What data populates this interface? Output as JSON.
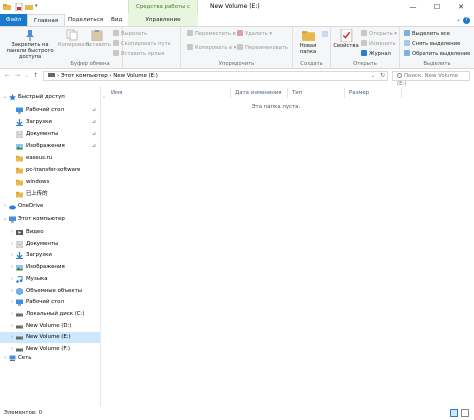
{
  "titlebar": {
    "context_tab": "Средства работы с дисками",
    "window_title": "New Volume (E:)",
    "minimize": "—",
    "maximize": "☐",
    "close": "✕"
  },
  "tabs": {
    "file": "Файл",
    "home": "Главная",
    "share": "Поделиться",
    "view": "Вид",
    "manage": "Управление"
  },
  "ribbon": {
    "clipboard": {
      "pin": "Закрепить на панели быстрого доступа",
      "copy": "Копировать",
      "paste": "Вставить",
      "cut": "Вырезать",
      "copy_path": "Скопировать путь",
      "paste_shortcut": "Вставить ярлык",
      "label": "Буфер обмена"
    },
    "organize": {
      "move_to": "Переместить в ▾",
      "copy_to": "Копировать в ▾",
      "delete": "Удалить ▾",
      "rename": "Переименовать",
      "label": "Упорядочить"
    },
    "new": {
      "new_folder": "Новая папка",
      "label": "Создать"
    },
    "open": {
      "properties": "Свойства",
      "open": "Открыть ▾",
      "edit": "Изменить",
      "history": "Журнал",
      "label": "Открыть"
    },
    "select": {
      "select_all": "Выделить все",
      "select_none": "Снять выделение",
      "invert": "Обратить выделение",
      "label": "Выделить"
    }
  },
  "address": {
    "path": "› Этот компьютер  ›  New Volume (E:)",
    "search_placeholder": "Поиск: New Volume (E:)"
  },
  "nav": {
    "quick_access": "Быстрый доступ",
    "items_quick": [
      {
        "label": "Рабочий стол",
        "icon": "desktop-icon",
        "pinned": true
      },
      {
        "label": "Загрузки",
        "icon": "downloads-icon",
        "pinned": true
      },
      {
        "label": "Документы",
        "icon": "documents-icon",
        "pinned": true
      },
      {
        "label": "Изображения",
        "icon": "pictures-icon",
        "pinned": true
      },
      {
        "label": "easeus.ru",
        "icon": "folder-icon",
        "pinned": false
      },
      {
        "label": "pc-transfer-software",
        "icon": "folder-icon",
        "pinned": false
      },
      {
        "label": "windows",
        "icon": "folder-icon",
        "pinned": false
      },
      {
        "label": "已上传的",
        "icon": "folder-icon",
        "pinned": false
      }
    ],
    "onedrive": "OneDrive",
    "this_pc": "Этот компьютер",
    "items_pc": [
      {
        "label": "Видео",
        "icon": "video-icon"
      },
      {
        "label": "Документы",
        "icon": "documents-icon"
      },
      {
        "label": "Загрузки",
        "icon": "downloads-icon"
      },
      {
        "label": "Изображения",
        "icon": "pictures-icon"
      },
      {
        "label": "Музыка",
        "icon": "music-icon"
      },
      {
        "label": "Объемные объекты",
        "icon": "3d-objects-icon"
      },
      {
        "label": "Рабочий стол",
        "icon": "desktop-icon"
      },
      {
        "label": "Локальный диск (C:)",
        "icon": "drive-icon"
      },
      {
        "label": "New Volume (D:)",
        "icon": "drive-icon"
      },
      {
        "label": "New Volume (E:)",
        "icon": "drive-icon",
        "selected": true
      },
      {
        "label": "New Volume (F:)",
        "icon": "drive-icon"
      }
    ],
    "network": "Сеть"
  },
  "content": {
    "columns": [
      "Имя",
      "Дата изменения",
      "Тип",
      "Размер"
    ],
    "empty_message": "Эта папка пуста."
  },
  "status": {
    "text": "Элементов: 0"
  },
  "colors": {
    "accent": "#1979ca",
    "context_green": "#e9f6df",
    "selected_bg": "#cce8ff"
  }
}
